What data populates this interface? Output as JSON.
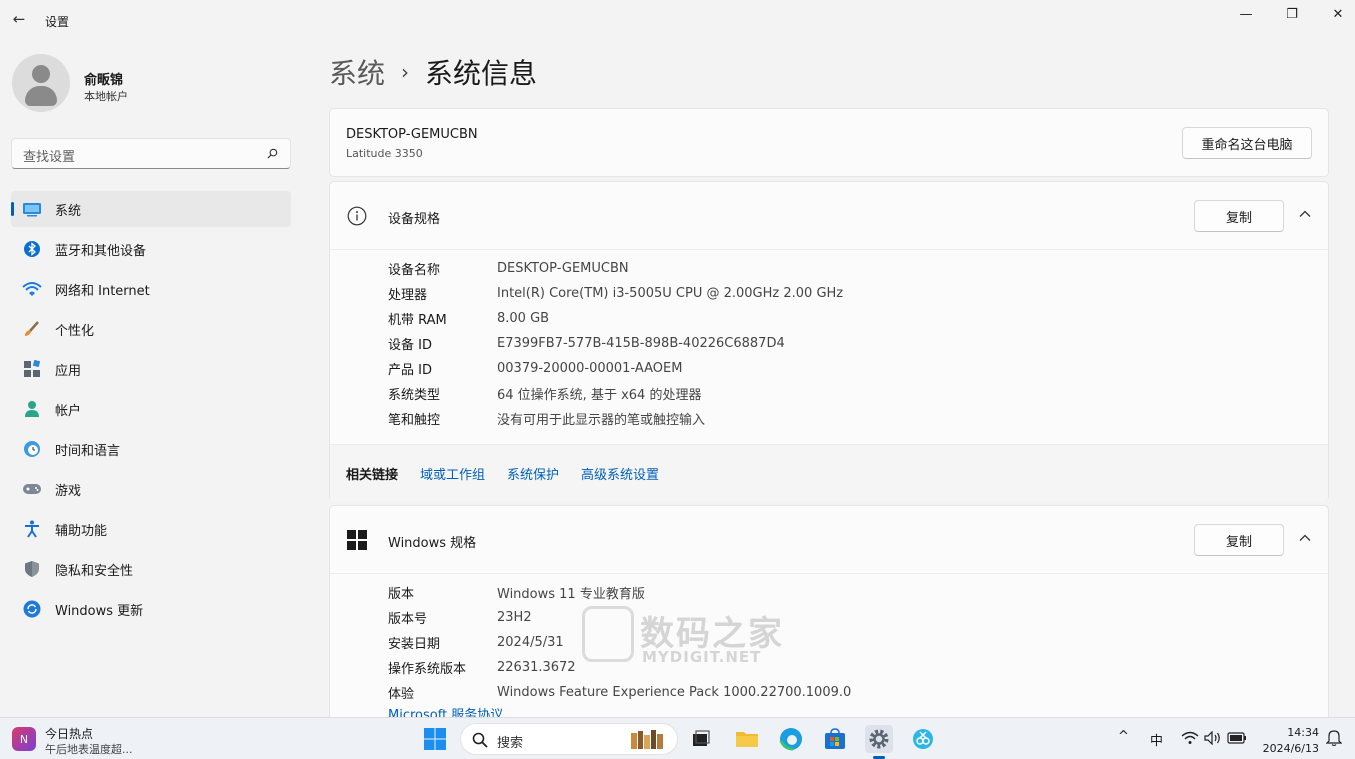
{
  "window": {
    "title": "设置",
    "back_glyph": "←",
    "minimize_glyph": "—",
    "maximize_glyph": "❐",
    "close_glyph": "✕"
  },
  "user": {
    "name": "俞畈锦",
    "account_type": "本地帐户"
  },
  "search": {
    "placeholder": "查找设置"
  },
  "sidebar": {
    "items": [
      {
        "label": "系统",
        "icon": "system-icon",
        "active": true
      },
      {
        "label": "蓝牙和其他设备",
        "icon": "bluetooth-icon"
      },
      {
        "label": "网络和 Internet",
        "icon": "wifi-icon"
      },
      {
        "label": "个性化",
        "icon": "brush-icon"
      },
      {
        "label": "应用",
        "icon": "apps-icon"
      },
      {
        "label": "帐户",
        "icon": "account-icon"
      },
      {
        "label": "时间和语言",
        "icon": "time-language-icon"
      },
      {
        "label": "游戏",
        "icon": "gamepad-icon"
      },
      {
        "label": "辅助功能",
        "icon": "accessibility-icon"
      },
      {
        "label": "隐私和安全性",
        "icon": "shield-icon"
      },
      {
        "label": "Windows 更新",
        "icon": "update-icon"
      }
    ]
  },
  "breadcrumb": {
    "parent": "系统",
    "separator": "›",
    "current": "系统信息"
  },
  "pc": {
    "name": "DESKTOP-GEMUCBN",
    "model": "Latitude 3350",
    "rename_label": "重命名这台电脑"
  },
  "device_specs": {
    "title": "设备规格",
    "copy_label": "复制",
    "rows": [
      {
        "key": "设备名称",
        "value": "DESKTOP-GEMUCBN"
      },
      {
        "key": "处理器",
        "value": "Intel(R) Core(TM) i3-5005U CPU @ 2.00GHz   2.00 GHz"
      },
      {
        "key": "机带 RAM",
        "value": "8.00 GB"
      },
      {
        "key": "设备 ID",
        "value": "E7399FB7-577B-415B-898B-40226C6887D4"
      },
      {
        "key": "产品 ID",
        "value": "00379-20000-00001-AAOEM"
      },
      {
        "key": "系统类型",
        "value": "64 位操作系统, 基于 x64 的处理器"
      },
      {
        "key": "笔和触控",
        "value": "没有可用于此显示器的笔或触控输入"
      }
    ]
  },
  "related_links": {
    "label": "相关链接",
    "links": [
      "域或工作组",
      "系统保护",
      "高级系统设置"
    ]
  },
  "windows_specs": {
    "title": "Windows 规格",
    "copy_label": "复制",
    "rows": [
      {
        "key": "版本",
        "value": "Windows 11 专业教育版"
      },
      {
        "key": "版本号",
        "value": "23H2"
      },
      {
        "key": "安装日期",
        "value": "2024/5/31"
      },
      {
        "key": "操作系统版本",
        "value": "22631.3672"
      },
      {
        "key": "体验",
        "value": "Windows Feature Experience Pack 1000.22700.1009.0"
      }
    ],
    "partial_link": "Microsoft 服务协议"
  },
  "watermark": {
    "main": "数码之家",
    "sub": "MYDIGIT.NET"
  },
  "taskbar": {
    "news_title": "今日热点",
    "news_sub": "午后地表温度超...",
    "search_label": "搜索",
    "tray_ime": "中",
    "tray_chevron": "^",
    "time": "14:34",
    "date": "2024/6/13"
  },
  "colors": {
    "accent": "#005fb8",
    "background": "#f3f3f3",
    "card": "#fbfbfb"
  }
}
